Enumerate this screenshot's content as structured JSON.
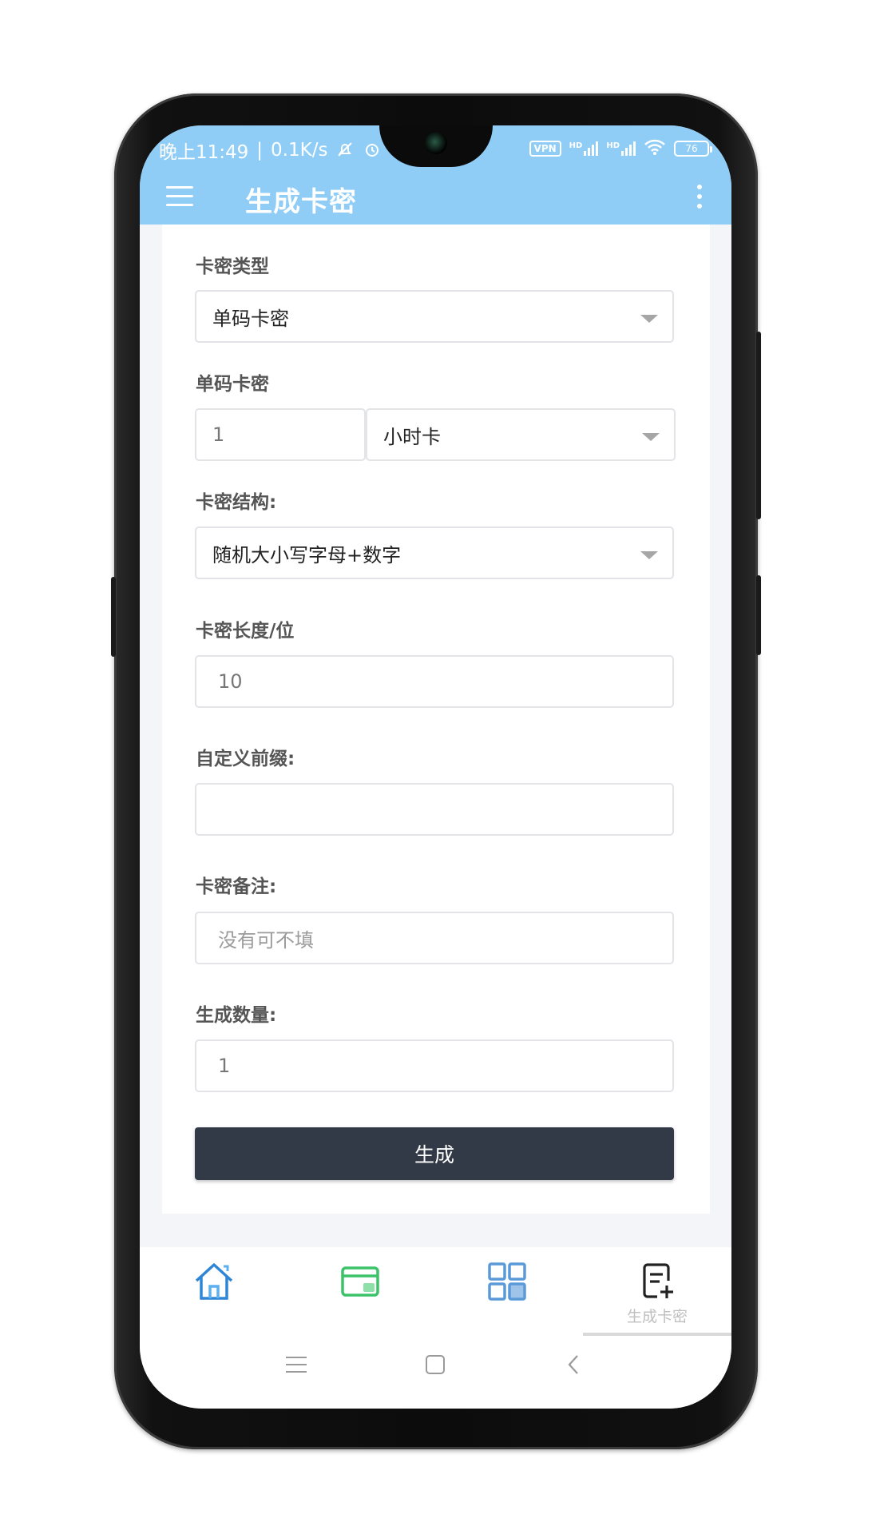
{
  "status_bar": {
    "time": "晚上11:49",
    "separator": "|",
    "speed": "0.1K/s",
    "vpn": "VPN",
    "signal_1": "HD",
    "signal_2": "HD",
    "battery": "76"
  },
  "app_bar": {
    "title": "生成卡密"
  },
  "form": {
    "card_type": {
      "label": "卡密类型",
      "value": "单码卡密"
    },
    "single_code": {
      "label": "单码卡密",
      "quantity": "1",
      "unit": "小时卡"
    },
    "structure": {
      "label": "卡密结构:",
      "value": "随机大小写字母+数字"
    },
    "length": {
      "label": "卡密长度/位",
      "value": "10"
    },
    "prefix": {
      "label": "自定义前缀:",
      "value": ""
    },
    "note": {
      "label": "卡密备注:",
      "placeholder": "没有可不填"
    },
    "count": {
      "label": "生成数量:",
      "value": "1"
    },
    "submit_label": "生成"
  },
  "bottom_nav": {
    "items": [
      {
        "icon": "home-icon",
        "color": "#2f86d6"
      },
      {
        "icon": "card-icon",
        "color": "#3cc36a"
      },
      {
        "icon": "grid-icon",
        "color": "#5b9ad8"
      },
      {
        "icon": "note-add-icon",
        "label": "生成卡密",
        "color": "#222222"
      }
    ]
  },
  "colors": {
    "header": "#8fcdf7",
    "button": "#333a47",
    "background": "#f4f5f9"
  }
}
